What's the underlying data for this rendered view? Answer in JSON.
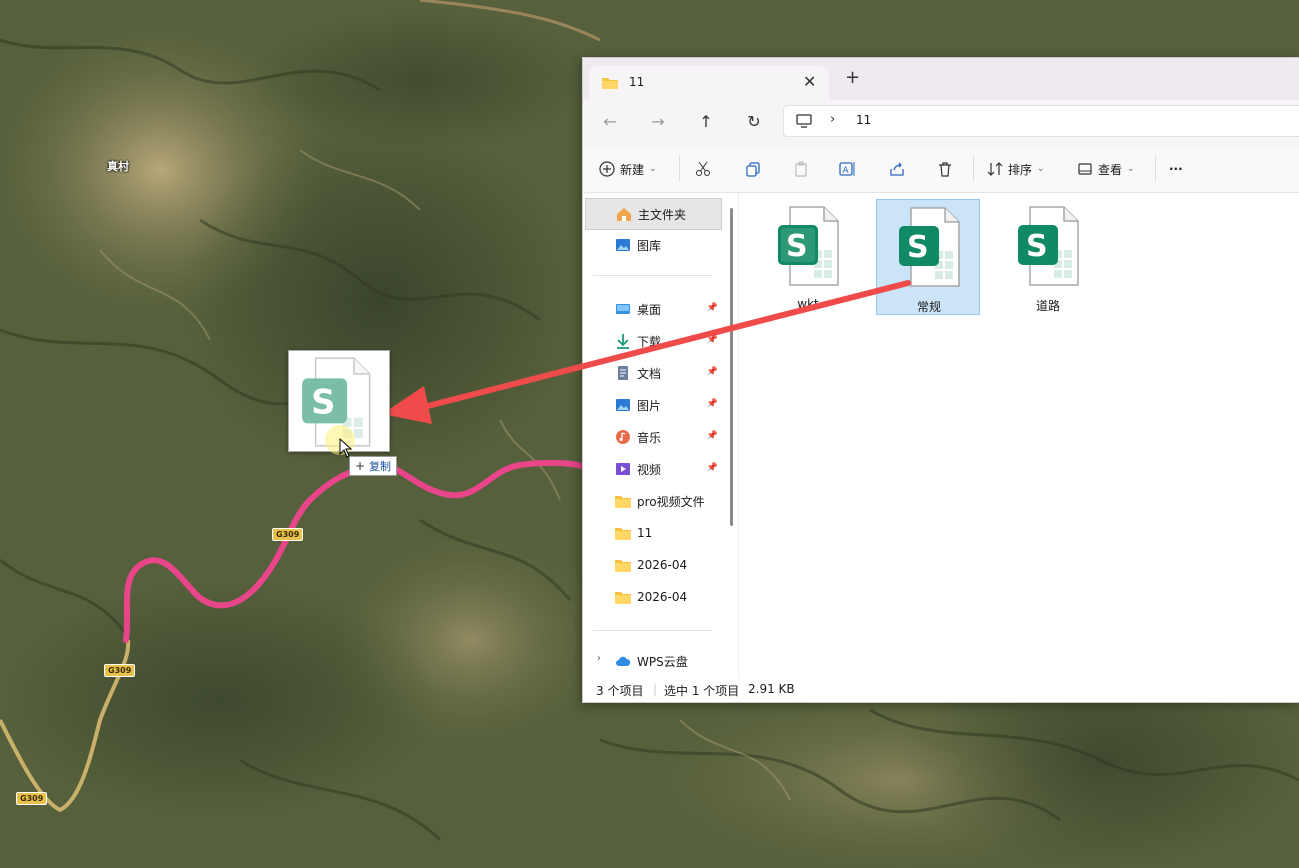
{
  "map": {
    "village_label": "真村",
    "road_shields": [
      "G309",
      "G309",
      "G309"
    ]
  },
  "explorer": {
    "tab_title": "11",
    "new_tab": "+",
    "address": {
      "separator": "›",
      "path": "11"
    },
    "toolbar": {
      "new_label": "新建",
      "sort_label": "排序",
      "view_label": "查看",
      "more_label": "···"
    },
    "nav": {
      "home": "主文件夹",
      "gallery": "图库",
      "desktop": "桌面",
      "downloads": "下载",
      "documents": "文档",
      "pictures": "图片",
      "music": "音乐",
      "videos": "视频",
      "folder1": "pro视频文件",
      "folder2": "11",
      "folder3": "2026-04",
      "folder4": "2026-04",
      "cloud": "WPS云盘"
    },
    "files": [
      {
        "name": "wkt"
      },
      {
        "name": "常规"
      },
      {
        "name": "道路"
      }
    ],
    "status": {
      "count": "3 个项目",
      "selection": "选中 1 个项目",
      "size": "2.91 KB"
    }
  },
  "drag": {
    "copy_label": "复制",
    "plus": "+"
  },
  "colors": {
    "route": "#e8458a",
    "arrow": "#f04b4b",
    "selection": "#cce4f7",
    "spreadsheet_green": "#0f8a64"
  },
  "icons": [
    "folder-icon",
    "spreadsheet-icon",
    "pin-icon",
    "cloud-icon",
    "cursor-icon"
  ]
}
